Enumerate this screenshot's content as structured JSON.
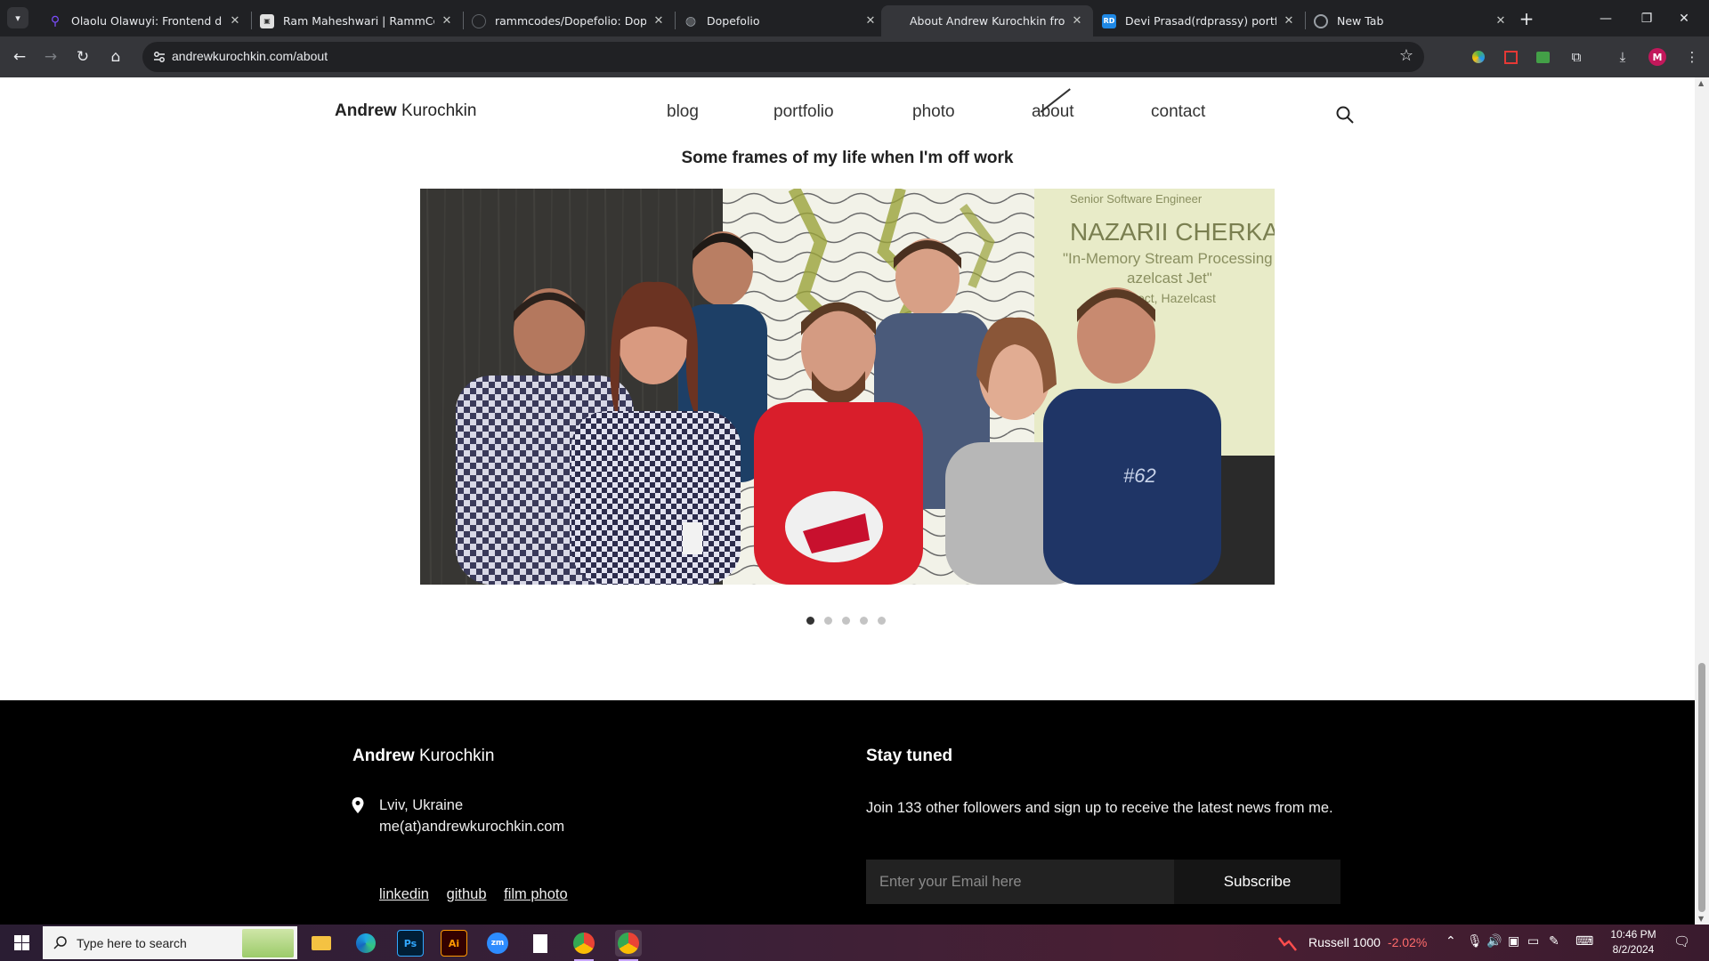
{
  "browser": {
    "tabs": [
      {
        "title": "Olaolu Olawuyi: Frontend deve",
        "favicon": "pin-icon",
        "color": "#7c4dff",
        "active": false
      },
      {
        "title": "Ram Maheshwari | RammCodes",
        "favicon": "portrait-icon",
        "color": "#5f6368",
        "active": false
      },
      {
        "title": "rammcodes/Dopefolio: Dopefo",
        "favicon": "github-icon",
        "color": "#202124",
        "active": false
      },
      {
        "title": "Dopefolio",
        "favicon": "globe-icon",
        "color": "#5f6368",
        "active": false
      },
      {
        "title": "About Andrew Kurochkin from",
        "favicon": "",
        "color": "#35363a",
        "active": true
      },
      {
        "title": "Devi Prasad(rdprassy) portfolio",
        "favicon": "rd-icon",
        "color": "#1976d2",
        "active": false
      },
      {
        "title": "New Tab",
        "favicon": "chrome-icon",
        "color": "#5f6368",
        "active": false
      }
    ],
    "url": "andrewkurochkin.com/about"
  },
  "site": {
    "logo_first": "Andrew",
    "logo_last": "Kurochkin",
    "menu": [
      "blog",
      "portfolio",
      "photo",
      "about",
      "contact"
    ],
    "current": "about"
  },
  "main": {
    "frames_title": "Some frames of my life when I'm off work",
    "carousel_slides": 5,
    "carousel_active": 1,
    "slide_text": {
      "line1": "Senior Software Engineer",
      "line2": "NAZARII CHERKAS",
      "line3": "\"In-Memory Stream Processing",
      "line4": "azelcast Jet\"",
      "line5": "ect, Hazelcast"
    }
  },
  "footer": {
    "logo_first": "Andrew",
    "logo_last": "Kurochkin",
    "city": "Lviv, Ukraine",
    "email": "me(at)andrewkurochkin.com",
    "links": [
      "linkedin",
      "github",
      "film photo"
    ],
    "stay_tuned": "Stay tuned",
    "join_text": "Join 133 other followers and sign up to receive the latest news from me.",
    "email_placeholder": "Enter your Email here",
    "subscribe": "Subscribe"
  },
  "taskbar": {
    "search_placeholder": "Type here to search",
    "ticker_name": "Russell 1000",
    "ticker_change": "-2.02%",
    "time": "10:46 PM",
    "date": "8/2/2024"
  }
}
